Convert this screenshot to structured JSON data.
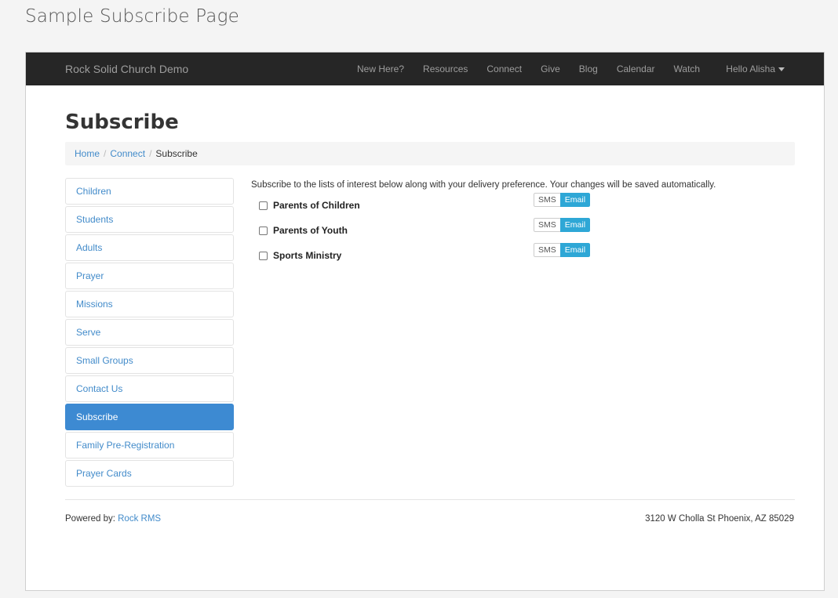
{
  "caption": "Sample Subscribe Page",
  "navbar": {
    "brand": "Rock Solid Church Demo",
    "links": [
      "New Here?",
      "Resources",
      "Connect",
      "Give",
      "Blog",
      "Calendar",
      "Watch"
    ],
    "user": "Hello Alisha"
  },
  "page": {
    "title": "Subscribe",
    "breadcrumb": [
      "Home",
      "Connect",
      "Subscribe"
    ]
  },
  "sidebar": {
    "items": [
      "Children",
      "Students",
      "Adults",
      "Prayer",
      "Missions",
      "Serve",
      "Small Groups",
      "Contact Us",
      "Subscribe",
      "Family Pre-Registration",
      "Prayer Cards"
    ],
    "active": "Subscribe"
  },
  "main": {
    "intro": "Subscribe to the lists of interest below along with your delivery preference. Your changes will be saved automatically.",
    "subscriptions": [
      {
        "label": "Parents of Children",
        "checked": false,
        "sms": "SMS",
        "email": "Email",
        "selected": "Email"
      },
      {
        "label": "Parents of Youth",
        "checked": false,
        "sms": "SMS",
        "email": "Email",
        "selected": "Email"
      },
      {
        "label": "Sports Ministry",
        "checked": false,
        "sms": "SMS",
        "email": "Email",
        "selected": "Email"
      }
    ]
  },
  "footer": {
    "powered_prefix": "Powered by: ",
    "powered_link": "Rock RMS",
    "address": "3120 W Cholla St Phoenix, AZ 85029"
  },
  "colors": {
    "navbar": "#262626",
    "link": "#428bca",
    "active_item": "#3d8ad2",
    "email_toggle": "#2ea7d6"
  }
}
